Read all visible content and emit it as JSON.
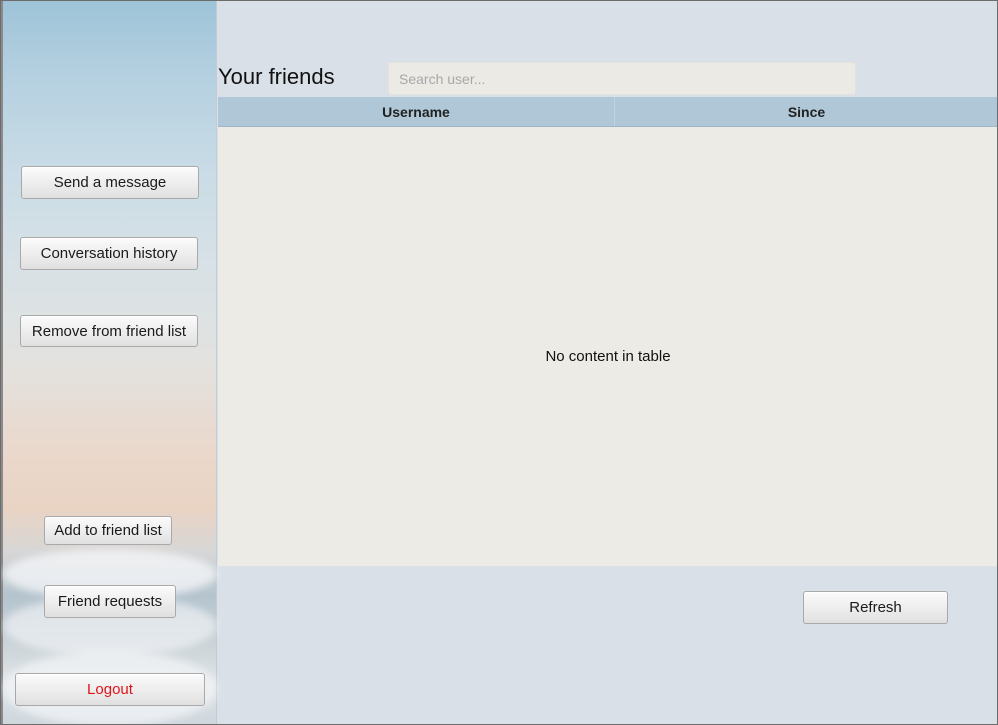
{
  "sidebar": {
    "send_message": "Send a message",
    "conversation_history": "Conversation history",
    "remove_friend": "Remove from friend list",
    "add_friend": "Add to friend list",
    "friend_requests": "Friend requests",
    "logout": "Logout"
  },
  "main": {
    "title": "Your friends",
    "search_placeholder": "Search user...",
    "table": {
      "columns": [
        "Username",
        "Since"
      ],
      "rows": [],
      "empty_message": "No content in table"
    },
    "refresh": "Refresh"
  },
  "colors": {
    "logout_text": "#e0141a",
    "table_header": "#afc7d6",
    "background": "#d9e0e8"
  }
}
